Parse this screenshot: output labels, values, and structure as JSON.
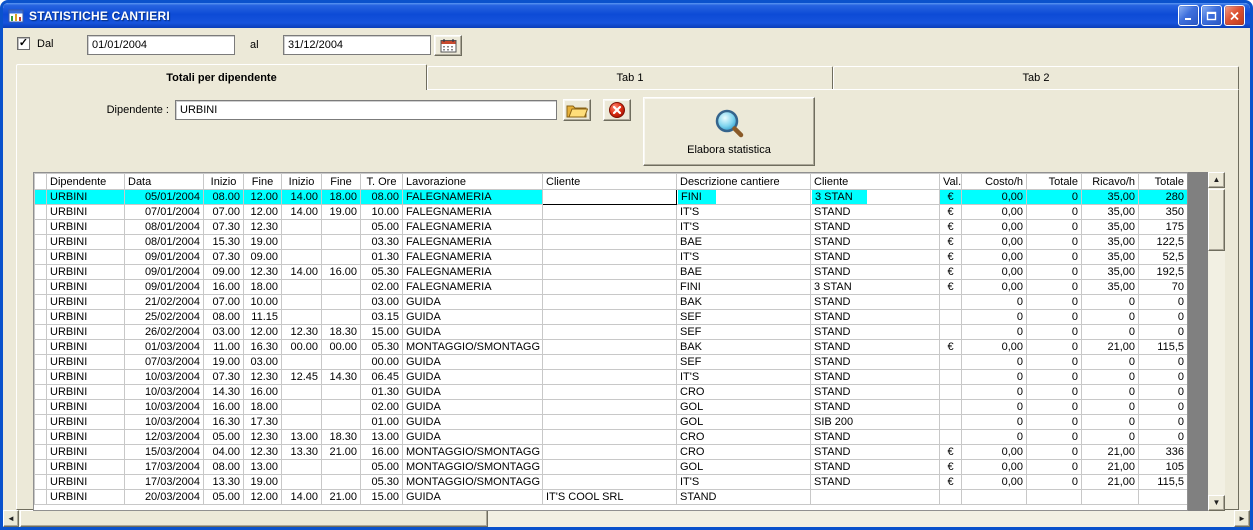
{
  "window": {
    "title": "STATISTICHE CANTIERI"
  },
  "filter": {
    "dal_label": "Dal",
    "dal_value": "01/01/2004",
    "al_label": "al",
    "al_value": "31/12/2004"
  },
  "tabs": [
    {
      "label": "Totali per dipendente",
      "active": true
    },
    {
      "label": "Tab 1",
      "active": false
    },
    {
      "label": "Tab 2",
      "active": false
    }
  ],
  "employee": {
    "label": "Dipendente :",
    "value": "URBINI",
    "elabora_label": "Elabora statistica"
  },
  "colors": {
    "selection": "#00FFFF",
    "titlebar_blue": "#1653DC",
    "filler_gray": "#808080"
  },
  "grid": {
    "columns": [
      "",
      "Dipendente",
      "Data",
      "Inizio",
      "Fine",
      "Inizio",
      "Fine",
      "T. Ore",
      "Lavorazione",
      "Cliente",
      "Descrizione cantiere",
      "Cliente",
      "Val.",
      "Costo/h",
      "Totale",
      "Ricavo/h",
      "Totale"
    ],
    "selected": {
      "row": 0,
      "active_cell_col": 9
    },
    "rows": [
      [
        "URBINI",
        "05/01/2004",
        "08.00",
        "12.00",
        "14.00",
        "18.00",
        "08.00",
        "FALEGNAMERIA",
        "",
        "FINI",
        "3 STAN",
        "€",
        "0,00",
        "0",
        "35,00",
        "280"
      ],
      [
        "URBINI",
        "07/01/2004",
        "07.00",
        "12.00",
        "14.00",
        "19.00",
        "10.00",
        "FALEGNAMERIA",
        "",
        "IT'S",
        "STAND",
        "€",
        "0,00",
        "0",
        "35,00",
        "350"
      ],
      [
        "URBINI",
        "08/01/2004",
        "07.30",
        "12.30",
        "",
        "",
        "05.00",
        "FALEGNAMERIA",
        "",
        "IT'S",
        "STAND",
        "€",
        "0,00",
        "0",
        "35,00",
        "175"
      ],
      [
        "URBINI",
        "08/01/2004",
        "15.30",
        "19.00",
        "",
        "",
        "03.30",
        "FALEGNAMERIA",
        "",
        "BAE",
        "STAND",
        "€",
        "0,00",
        "0",
        "35,00",
        "122,5"
      ],
      [
        "URBINI",
        "09/01/2004",
        "07.30",
        "09.00",
        "",
        "",
        "01.30",
        "FALEGNAMERIA",
        "",
        "IT'S",
        "STAND",
        "€",
        "0,00",
        "0",
        "35,00",
        "52,5"
      ],
      [
        "URBINI",
        "09/01/2004",
        "09.00",
        "12.30",
        "14.00",
        "16.00",
        "05.30",
        "FALEGNAMERIA",
        "",
        "BAE",
        "STAND",
        "€",
        "0,00",
        "0",
        "35,00",
        "192,5"
      ],
      [
        "URBINI",
        "09/01/2004",
        "16.00",
        "18.00",
        "",
        "",
        "02.00",
        "FALEGNAMERIA",
        "",
        "FINI",
        "3 STAN",
        "€",
        "0,00",
        "0",
        "35,00",
        "70"
      ],
      [
        "URBINI",
        "21/02/2004",
        "07.00",
        "10.00",
        "",
        "",
        "03.00",
        "GUIDA",
        "",
        "BAK",
        "STAND",
        "",
        "0",
        "0",
        "0",
        "0"
      ],
      [
        "URBINI",
        "25/02/2004",
        "08.00",
        "11.15",
        "",
        "",
        "03.15",
        "GUIDA",
        "",
        "SEF",
        "STAND",
        "",
        "0",
        "0",
        "0",
        "0"
      ],
      [
        "URBINI",
        "26/02/2004",
        "03.00",
        "12.00",
        "12.30",
        "18.30",
        "15.00",
        "GUIDA",
        "",
        "SEF",
        "STAND",
        "",
        "0",
        "0",
        "0",
        "0"
      ],
      [
        "URBINI",
        "01/03/2004",
        "11.00",
        "16.30",
        "00.00",
        "00.00",
        "05.30",
        "MONTAGGIO/SMONTAGG",
        "",
        "BAK",
        "STAND",
        "€",
        "0,00",
        "0",
        "21,00",
        "115,5"
      ],
      [
        "URBINI",
        "07/03/2004",
        "19.00",
        "03.00",
        "",
        "",
        "00.00",
        "GUIDA",
        "",
        "SEF",
        "STAND",
        "",
        "0",
        "0",
        "0",
        "0"
      ],
      [
        "URBINI",
        "10/03/2004",
        "07.30",
        "12.30",
        "12.45",
        "14.30",
        "06.45",
        "GUIDA",
        "",
        "IT'S",
        "STAND",
        "",
        "0",
        "0",
        "0",
        "0"
      ],
      [
        "URBINI",
        "10/03/2004",
        "14.30",
        "16.00",
        "",
        "",
        "01.30",
        "GUIDA",
        "",
        "CRO",
        "STAND",
        "",
        "0",
        "0",
        "0",
        "0"
      ],
      [
        "URBINI",
        "10/03/2004",
        "16.00",
        "18.00",
        "",
        "",
        "02.00",
        "GUIDA",
        "",
        "GOL",
        "STAND",
        "",
        "0",
        "0",
        "0",
        "0"
      ],
      [
        "URBINI",
        "10/03/2004",
        "16.30",
        "17.30",
        "",
        "",
        "01.00",
        "GUIDA",
        "",
        "GOL",
        "SIB 200",
        "",
        "0",
        "0",
        "0",
        "0"
      ],
      [
        "URBINI",
        "12/03/2004",
        "05.00",
        "12.30",
        "13.00",
        "18.30",
        "13.00",
        "GUIDA",
        "",
        "CRO",
        "STAND",
        "",
        "0",
        "0",
        "0",
        "0"
      ],
      [
        "URBINI",
        "15/03/2004",
        "04.00",
        "12.30",
        "13.30",
        "21.00",
        "16.00",
        "MONTAGGIO/SMONTAGG",
        "",
        "CRO",
        "STAND",
        "€",
        "0,00",
        "0",
        "21,00",
        "336"
      ],
      [
        "URBINI",
        "17/03/2004",
        "08.00",
        "13.00",
        "",
        "",
        "05.00",
        "MONTAGGIO/SMONTAGG",
        "",
        "GOL",
        "STAND",
        "€",
        "0,00",
        "0",
        "21,00",
        "105"
      ],
      [
        "URBINI",
        "17/03/2004",
        "13.30",
        "19.00",
        "",
        "",
        "05.30",
        "MONTAGGIO/SMONTAGG",
        "",
        "IT'S",
        "STAND",
        "€",
        "0,00",
        "0",
        "21,00",
        "115,5"
      ],
      [
        "URBINI",
        "20/03/2004",
        "05.00",
        "12.00",
        "14.00",
        "21.00",
        "15.00",
        "GUIDA",
        "IT'S COOL SRL",
        "STAND",
        "",
        "",
        "",
        "",
        "",
        ""
      ]
    ]
  }
}
